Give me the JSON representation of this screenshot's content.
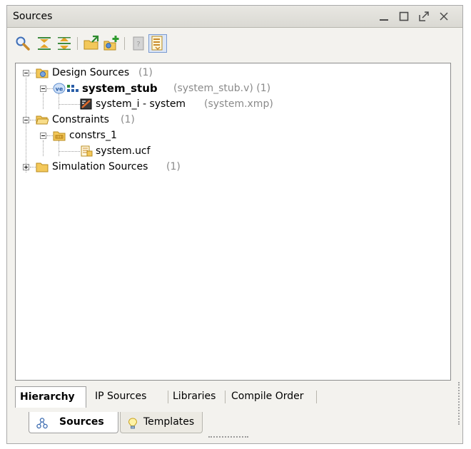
{
  "panel": {
    "title": "Sources",
    "window_controls": [
      "minimize-icon",
      "maximize-icon",
      "float-icon",
      "close-icon"
    ]
  },
  "toolbar": {
    "buttons": [
      {
        "icon": "search-icon"
      },
      {
        "icon": "collapse-all-icon"
      },
      {
        "icon": "expand-all-icon"
      },
      {
        "icon": "add-sources-icon"
      },
      {
        "icon": "add-hierarchy-icon"
      },
      {
        "icon": "properties-icon"
      },
      {
        "icon": "show-hierarchy-icon",
        "active": true
      }
    ]
  },
  "tree": {
    "design_sources": {
      "label": "Design Sources",
      "count": "(1)"
    },
    "system_stub": {
      "label": "system_stub",
      "detail": "(system_stub.v) (1)"
    },
    "system_i": {
      "label": "system_i - system",
      "detail": "(system.xmp)"
    },
    "constraints": {
      "label": "Constraints",
      "count": "(1)"
    },
    "constrs_1": {
      "label": "constrs_1"
    },
    "system_ucf": {
      "label": "system.ucf"
    },
    "simulation_sources": {
      "label": "Simulation Sources",
      "count": "(1)"
    }
  },
  "view_tabs": [
    "Hierarchy",
    "IP Sources",
    "Libraries",
    "Compile Order"
  ],
  "bottom_tabs": [
    {
      "label": "Sources",
      "selected": true
    },
    {
      "label": "Templates",
      "selected": false
    }
  ],
  "colors": {
    "panel_bg": "#f3f2ee",
    "folder_yellow": "#f3c85a",
    "gray_text": "#8a8a8a"
  }
}
